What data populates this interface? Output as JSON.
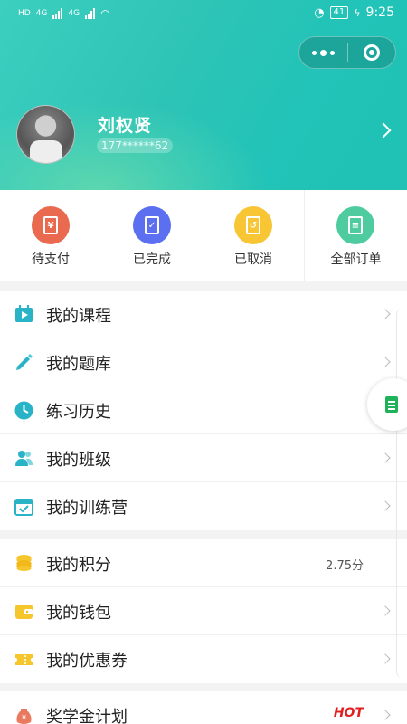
{
  "status_bar": {
    "left_tags": [
      "HD",
      "4G",
      "4G"
    ],
    "battery": "41",
    "time": "9:25"
  },
  "capsule": {
    "more_icon": "more-dots-icon",
    "close_icon": "target-ring-icon"
  },
  "user": {
    "name": "刘权贤",
    "phone": "177******62"
  },
  "orders": [
    {
      "label": "待支付",
      "icon": "yuan-doc-icon",
      "color": "#ea6a4f"
    },
    {
      "label": "已完成",
      "icon": "checked-doc-icon",
      "color": "#5b6ff0"
    },
    {
      "label": "已取消",
      "icon": "cancel-doc-icon",
      "color": "#f8c535"
    },
    {
      "label": "全部订单",
      "icon": "all-orders-icon",
      "color": "#4ecca0"
    }
  ],
  "menu_group_1": [
    {
      "label": "我的课程",
      "icon": "course-play-icon"
    },
    {
      "label": "我的题库",
      "icon": "pencil-icon"
    },
    {
      "label": "练习历史",
      "icon": "clock-icon"
    },
    {
      "label": "我的班级",
      "icon": "people-icon"
    },
    {
      "label": "我的训练营",
      "icon": "calendar-check-icon"
    }
  ],
  "menu_group_2": [
    {
      "label": "我的积分",
      "icon": "coin-stack-icon",
      "value": "2.75分"
    },
    {
      "label": "我的钱包",
      "icon": "wallet-icon"
    },
    {
      "label": "我的优惠券",
      "icon": "coupon-icon"
    }
  ],
  "menu_group_3": [
    {
      "label": "奖学金计划",
      "icon": "money-bag-icon",
      "badge": "HOT"
    }
  ],
  "colors": {
    "header_start": "#3ccfc0",
    "header_end": "#1fc2b4",
    "hot": "#e02020"
  }
}
